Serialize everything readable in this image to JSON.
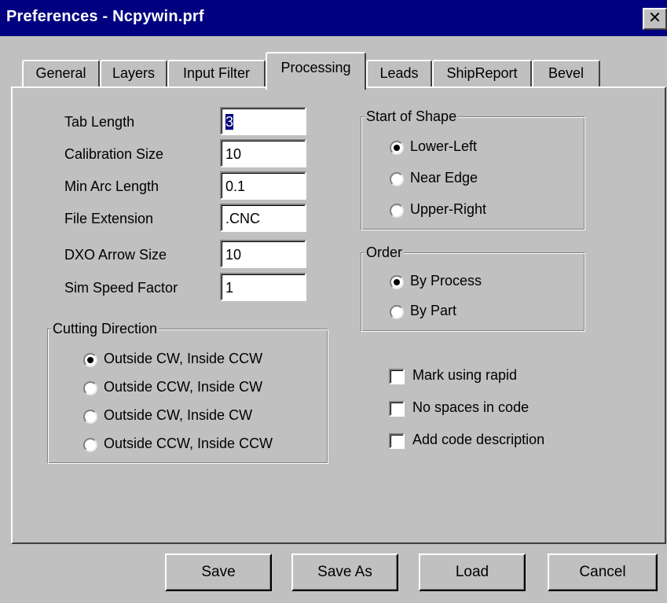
{
  "window": {
    "title": "Preferences - Ncpywin.prf",
    "close_symbol": "✕"
  },
  "tabs": [
    {
      "label": "General",
      "active": false
    },
    {
      "label": "Layers",
      "active": false
    },
    {
      "label": "Input Filter",
      "active": false
    },
    {
      "label": "Processing",
      "active": true
    },
    {
      "label": "Leads",
      "active": false
    },
    {
      "label": "ShipReport",
      "active": false
    },
    {
      "label": "Bevel",
      "active": false
    }
  ],
  "fields": [
    {
      "label": "Tab Length",
      "value": "3"
    },
    {
      "label": "Calibration Size",
      "value": "10"
    },
    {
      "label": "Min Arc Length",
      "value": "0.1"
    },
    {
      "label": "File Extension",
      "value": ".CNC"
    },
    {
      "label": "DXO Arrow Size",
      "value": "10"
    },
    {
      "label": "Sim Speed Factor",
      "value": "1"
    }
  ],
  "cutting_direction": {
    "title": "Cutting Direction",
    "options": [
      {
        "label": "Outside CW, Inside CCW",
        "selected": true
      },
      {
        "label": "Outside CCW, Inside CW",
        "selected": false
      },
      {
        "label": "Outside CW, Inside CW",
        "selected": false
      },
      {
        "label": "Outside CCW, Inside CCW",
        "selected": false
      }
    ]
  },
  "start_of_shape": {
    "title": "Start of Shape",
    "options": [
      {
        "label": "Lower-Left",
        "selected": true
      },
      {
        "label": "Near Edge",
        "selected": false
      },
      {
        "label": "Upper-Right",
        "selected": false
      }
    ]
  },
  "order": {
    "title": "Order",
    "options": [
      {
        "label": "By Process",
        "selected": true
      },
      {
        "label": "By Part",
        "selected": false
      }
    ]
  },
  "checkboxes": [
    {
      "label": "Mark using rapid",
      "checked": false
    },
    {
      "label": "No spaces in code",
      "checked": false
    },
    {
      "label": "Add code description",
      "checked": false
    }
  ],
  "buttons": {
    "save": "Save",
    "save_as": "Save As",
    "load": "Load",
    "cancel": "Cancel"
  }
}
